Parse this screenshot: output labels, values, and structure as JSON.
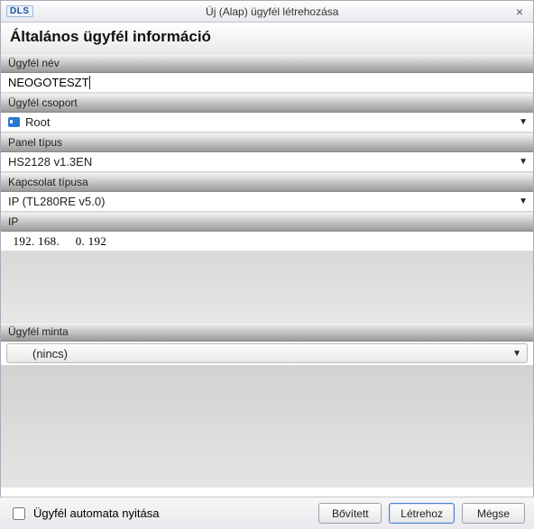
{
  "window": {
    "logo": "DLS",
    "title": "Új (Alap) ügyfél létrehozása",
    "close": "×"
  },
  "section": {
    "title": "Általános ügyfél információ"
  },
  "fields": {
    "name_label": "Ügyfél név",
    "name_value": "NEOGOTESZT",
    "group_label": "Ügyfél csoport",
    "group_value": "Root",
    "panel_label": "Panel típus",
    "panel_value": "HS2128 v1.3EN",
    "connect_label": "Kapcsolat típusa",
    "connect_value": "IP   (TL280RE v5.0)",
    "ip_label": "IP",
    "ip_value": " 192. 168.     0. 192",
    "sample_label": "Ügyfél minta",
    "sample_value": "(nincs)"
  },
  "footer": {
    "auto_open": "Ügyfél automata nyitása",
    "advanced": "Bővített",
    "create": "Létrehoz",
    "cancel": "Mégse"
  }
}
